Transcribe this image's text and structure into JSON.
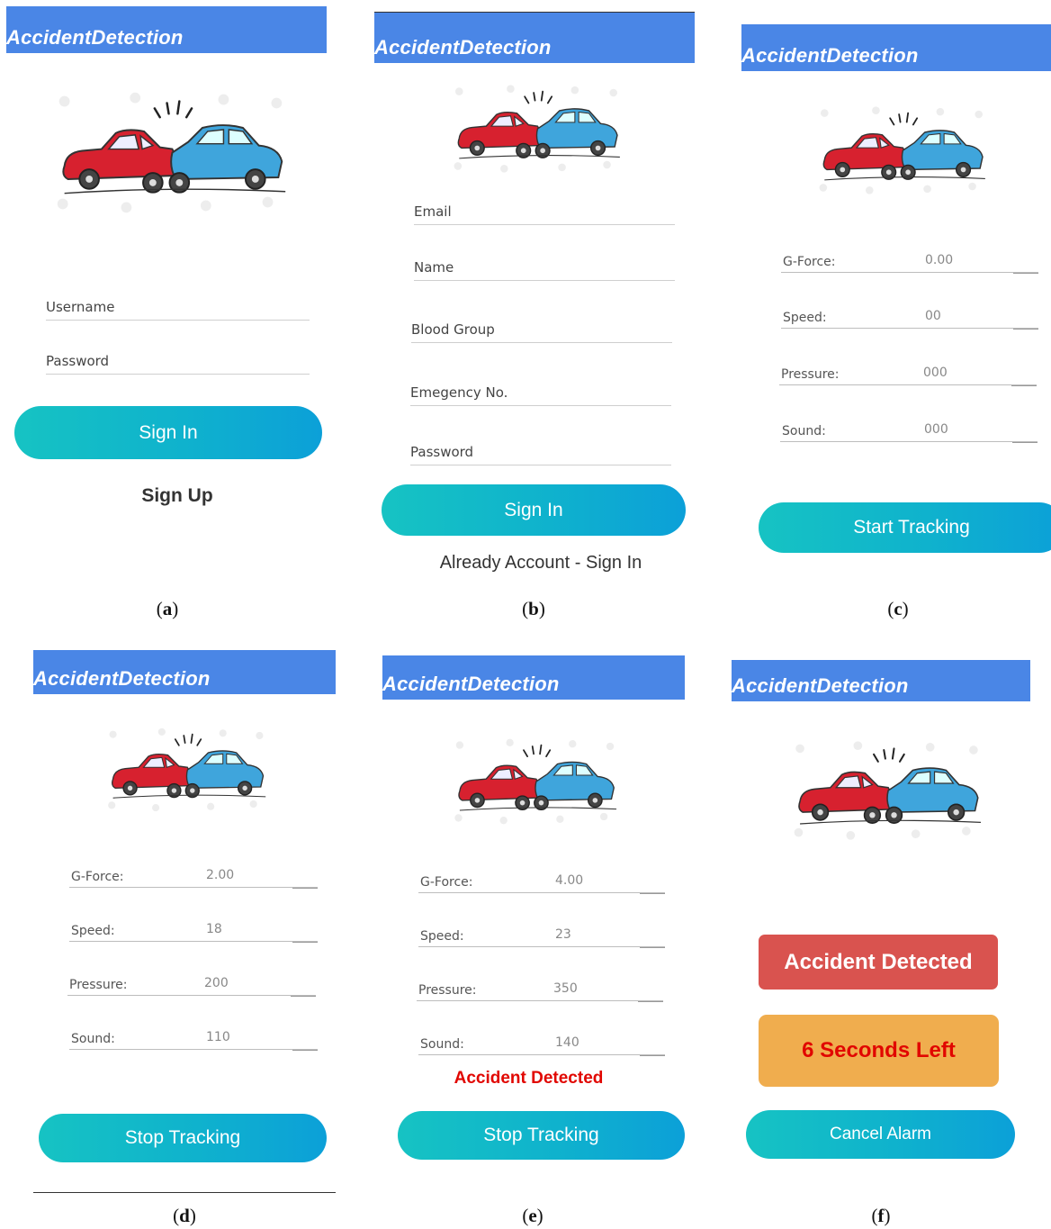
{
  "app_title": "AccidentDetection",
  "colors": {
    "appbar": "#4a86e6",
    "button_start": "#16c3c3",
    "button_end": "#0ca0d8",
    "alert_red": "#d9534f",
    "alert_orange": "#f0ad4e",
    "alert_text_red": "#e10600"
  },
  "icons": {
    "logo": "car-crash-icon"
  },
  "screens": {
    "a": {
      "caption": "a",
      "fields": {
        "username": "Username",
        "password": "Password"
      },
      "sign_in": "Sign In",
      "sign_up": "Sign Up"
    },
    "b": {
      "caption": "b",
      "fields": {
        "email": "Email",
        "name": "Name",
        "blood_group": "Blood Group",
        "emergency": "Emegency No.",
        "password": "Password"
      },
      "sign_in": "Sign In",
      "already": "Already Account - Sign In"
    },
    "c": {
      "caption": "c",
      "rows": [
        {
          "label": "G-Force:",
          "value": "0.00"
        },
        {
          "label": "Speed:",
          "value": "00"
        },
        {
          "label": "Pressure:",
          "value": "000"
        },
        {
          "label": "Sound:",
          "value": "000"
        }
      ],
      "button": "Start Tracking"
    },
    "d": {
      "caption": "d",
      "rows": [
        {
          "label": "G-Force:",
          "value": "2.00"
        },
        {
          "label": "Speed:",
          "value": "18"
        },
        {
          "label": "Pressure:",
          "value": "200"
        },
        {
          "label": "Sound:",
          "value": "110"
        }
      ],
      "button": "Stop Tracking"
    },
    "e": {
      "caption": "e",
      "rows": [
        {
          "label": "G-Force:",
          "value": "4.00"
        },
        {
          "label": "Speed:",
          "value": "23"
        },
        {
          "label": "Pressure:",
          "value": "350"
        },
        {
          "label": "Sound:",
          "value": "140"
        }
      ],
      "status": "Accident Detected",
      "button": "Stop Tracking"
    },
    "f": {
      "caption": "f",
      "alert": "Accident Detected",
      "countdown": "6 Seconds Left",
      "button": "Cancel Alarm"
    }
  }
}
